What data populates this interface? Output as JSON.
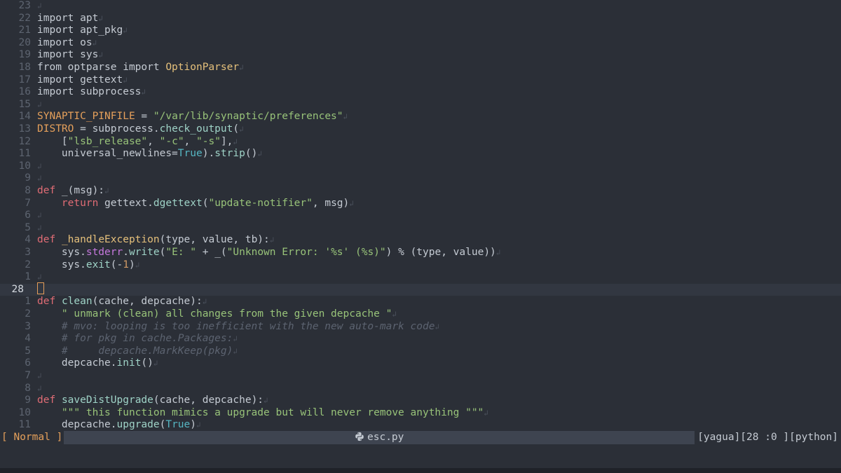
{
  "editor": {
    "lines": [
      {
        "ln": "23",
        "eol": "↲",
        "current": false,
        "tokens": []
      },
      {
        "ln": "22",
        "eol": "↲",
        "current": false,
        "tokens": [
          {
            "t": "import apt",
            "c": "plain"
          }
        ]
      },
      {
        "ln": "21",
        "eol": "↲",
        "current": false,
        "tokens": [
          {
            "t": "import apt_pkg",
            "c": "plain"
          }
        ]
      },
      {
        "ln": "20",
        "eol": "↲",
        "current": false,
        "tokens": [
          {
            "t": "import os",
            "c": "plain"
          }
        ]
      },
      {
        "ln": "19",
        "eol": "↲",
        "current": false,
        "tokens": [
          {
            "t": "import sys",
            "c": "plain"
          }
        ]
      },
      {
        "ln": "18",
        "eol": "↲",
        "current": false,
        "tokens": [
          {
            "t": "from optparse import ",
            "c": "plain"
          },
          {
            "t": "OptionParser",
            "c": "cls"
          }
        ]
      },
      {
        "ln": "17",
        "eol": "↲",
        "current": false,
        "tokens": [
          {
            "t": "import gettext",
            "c": "plain"
          }
        ]
      },
      {
        "ln": "16",
        "eol": "↲",
        "current": false,
        "tokens": [
          {
            "t": "import subprocess",
            "c": "plain"
          }
        ]
      },
      {
        "ln": "15",
        "eol": "↲",
        "current": false,
        "tokens": []
      },
      {
        "ln": "14",
        "eol": "↲",
        "current": false,
        "tokens": [
          {
            "t": "SYNAPTIC_PINFILE",
            "c": "const"
          },
          {
            "t": " = ",
            "c": "plain"
          },
          {
            "t": "\"/var/lib/synaptic/preferences\"",
            "c": "str"
          }
        ]
      },
      {
        "ln": "13",
        "eol": "↲",
        "current": false,
        "tokens": [
          {
            "t": "DISTRO",
            "c": "const"
          },
          {
            "t": " = subprocess.",
            "c": "plain"
          },
          {
            "t": "check_output",
            "c": "fn"
          },
          {
            "t": "(",
            "c": "plain"
          }
        ]
      },
      {
        "ln": "12",
        "eol": "↲",
        "current": false,
        "tokens": [
          {
            "t": "    [",
            "c": "plain"
          },
          {
            "t": "\"lsb_release\"",
            "c": "str"
          },
          {
            "t": ", ",
            "c": "plain"
          },
          {
            "t": "\"-c\"",
            "c": "str"
          },
          {
            "t": ", ",
            "c": "plain"
          },
          {
            "t": "\"-s\"",
            "c": "str"
          },
          {
            "t": "],",
            "c": "plain"
          }
        ]
      },
      {
        "ln": "11",
        "eol": "↲",
        "current": false,
        "tokens": [
          {
            "t": "    universal_newlines=",
            "c": "plain"
          },
          {
            "t": "True",
            "c": "bool"
          },
          {
            "t": ").",
            "c": "plain"
          },
          {
            "t": "strip",
            "c": "fn"
          },
          {
            "t": "()",
            "c": "plain"
          }
        ]
      },
      {
        "ln": "10",
        "eol": "↲",
        "current": false,
        "tokens": []
      },
      {
        "ln": "9",
        "eol": "↲",
        "current": false,
        "tokens": []
      },
      {
        "ln": "8",
        "eol": "↲",
        "current": false,
        "tokens": [
          {
            "t": "def",
            "c": "kw"
          },
          {
            "t": " _(msg):",
            "c": "plain"
          }
        ]
      },
      {
        "ln": "7",
        "eol": "↲",
        "current": false,
        "tokens": [
          {
            "t": "    ",
            "c": "plain"
          },
          {
            "t": "return",
            "c": "kw"
          },
          {
            "t": " gettext.",
            "c": "plain"
          },
          {
            "t": "dgettext",
            "c": "fn"
          },
          {
            "t": "(",
            "c": "plain"
          },
          {
            "t": "\"update-notifier\"",
            "c": "str"
          },
          {
            "t": ", msg)",
            "c": "plain"
          }
        ]
      },
      {
        "ln": "6",
        "eol": "↲",
        "current": false,
        "tokens": []
      },
      {
        "ln": "5",
        "eol": "↲",
        "current": false,
        "tokens": []
      },
      {
        "ln": "4",
        "eol": "↲",
        "current": false,
        "tokens": [
          {
            "t": "def",
            "c": "kw"
          },
          {
            "t": " ",
            "c": "plain"
          },
          {
            "t": "_handleException",
            "c": "cls"
          },
          {
            "t": "(type, value, tb):",
            "c": "plain"
          }
        ]
      },
      {
        "ln": "3",
        "eol": "↲",
        "current": false,
        "tokens": [
          {
            "t": "    sys.",
            "c": "plain"
          },
          {
            "t": "stderr",
            "c": "attr"
          },
          {
            "t": ".",
            "c": "plain"
          },
          {
            "t": "write",
            "c": "fn"
          },
          {
            "t": "(",
            "c": "plain"
          },
          {
            "t": "\"E: \"",
            "c": "str"
          },
          {
            "t": " + _(",
            "c": "plain"
          },
          {
            "t": "\"Unknown Error: '%s' (%s)\"",
            "c": "str"
          },
          {
            "t": ") % (type, value))",
            "c": "plain"
          }
        ]
      },
      {
        "ln": "2",
        "eol": "↲",
        "current": false,
        "tokens": [
          {
            "t": "    sys.",
            "c": "plain"
          },
          {
            "t": "exit",
            "c": "fn"
          },
          {
            "t": "(-",
            "c": "plain"
          },
          {
            "t": "1",
            "c": "num"
          },
          {
            "t": ")",
            "c": "plain"
          }
        ]
      },
      {
        "ln": "1",
        "eol": "↲",
        "current": false,
        "tokens": []
      },
      {
        "ln": "28",
        "eol": "",
        "current": true,
        "tokens": []
      },
      {
        "ln": "1",
        "eol": "↲",
        "current": false,
        "tokens": [
          {
            "t": "def",
            "c": "kw"
          },
          {
            "t": " ",
            "c": "plain"
          },
          {
            "t": "clean",
            "c": "fn"
          },
          {
            "t": "(cache, depcache):",
            "c": "plain"
          }
        ]
      },
      {
        "ln": "2",
        "eol": "↲",
        "current": false,
        "tokens": [
          {
            "t": "    ",
            "c": "plain"
          },
          {
            "t": "\" unmark (clean) all changes from the given depcache \"",
            "c": "str"
          }
        ]
      },
      {
        "ln": "3",
        "eol": "↲",
        "current": false,
        "tokens": [
          {
            "t": "    # mvo: looping is too inefficient with the new auto-mark code",
            "c": "cmt"
          }
        ]
      },
      {
        "ln": "4",
        "eol": "↲",
        "current": false,
        "tokens": [
          {
            "t": "    # for pkg in cache.Packages:",
            "c": "cmt"
          }
        ]
      },
      {
        "ln": "5",
        "eol": "↲",
        "current": false,
        "tokens": [
          {
            "t": "    #     depcache.MarkKeep(pkg)",
            "c": "cmt"
          }
        ]
      },
      {
        "ln": "6",
        "eol": "↲",
        "current": false,
        "tokens": [
          {
            "t": "    depcache.",
            "c": "plain"
          },
          {
            "t": "init",
            "c": "fn"
          },
          {
            "t": "()",
            "c": "plain"
          }
        ]
      },
      {
        "ln": "7",
        "eol": "↲",
        "current": false,
        "tokens": []
      },
      {
        "ln": "8",
        "eol": "↲",
        "current": false,
        "tokens": []
      },
      {
        "ln": "9",
        "eol": "↲",
        "current": false,
        "tokens": [
          {
            "t": "def",
            "c": "kw"
          },
          {
            "t": " ",
            "c": "plain"
          },
          {
            "t": "saveDistUpgrade",
            "c": "fn"
          },
          {
            "t": "(cache, depcache):",
            "c": "plain"
          }
        ]
      },
      {
        "ln": "10",
        "eol": "↲",
        "current": false,
        "tokens": [
          {
            "t": "    ",
            "c": "plain"
          },
          {
            "t": "\"\"\" this function mimics a upgrade but will never remove anything \"\"\"",
            "c": "str"
          }
        ]
      },
      {
        "ln": "11",
        "eol": "↲",
        "current": false,
        "tokens": [
          {
            "t": "    depcache.",
            "c": "plain"
          },
          {
            "t": "upgrade",
            "c": "fn"
          },
          {
            "t": "(",
            "c": "plain"
          },
          {
            "t": "True",
            "c": "bool"
          },
          {
            "t": ")",
            "c": "plain"
          }
        ]
      }
    ]
  },
  "statusbar": {
    "mode": "[ Normal ]",
    "file_icon": "python-icon",
    "filename": "esc.py",
    "right": "[yagua][28 :0 ][python]"
  },
  "colors": {
    "background": "#2b2f37",
    "keyword": "#e06c75",
    "string": "#98c379",
    "class": "#e5c07b",
    "constant": "#e5a05b",
    "function": "#9fd3c7",
    "comment": "#5c6370"
  }
}
